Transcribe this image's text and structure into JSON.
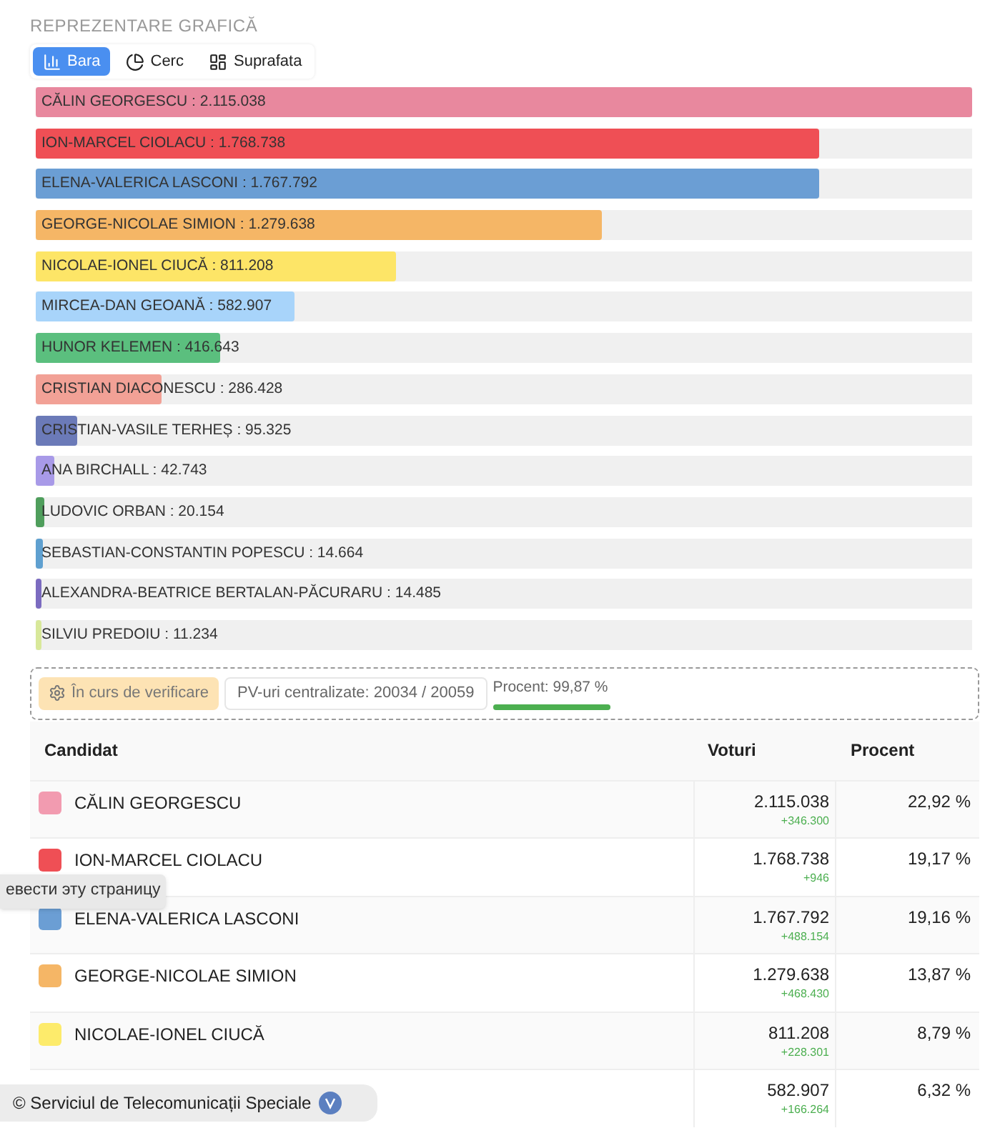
{
  "section_title": "REPREZENTARE GRAFICĂ",
  "tabs": [
    {
      "label": "Bara",
      "selected": true
    },
    {
      "label": "Cerc",
      "selected": false
    },
    {
      "label": "Suprafata",
      "selected": false
    }
  ],
  "bars": [
    {
      "label": "CĂLIN GEORGESCU : 2.115.038",
      "level": 1,
      "color": "#e8889e"
    },
    {
      "label": "ION-MARCEL CIOLACU : 1.768.738",
      "level": 0.836,
      "color": "#ef4f55"
    },
    {
      "label": "ELENA-VALERICA LASCONI : 1.767.792",
      "level": 0.836,
      "color": "#6b9ed4"
    },
    {
      "label": "GEORGE-NICOLAE SIMION : 1.279.638",
      "level": 0.605,
      "color": "#f5b666"
    },
    {
      "label": "NICOLAE-IONEL CIUCĂ : 811.208",
      "level": 0.384,
      "color": "#fde567"
    },
    {
      "label": "MIRCEA-DAN GEOANĂ : 582.907",
      "level": 0.276,
      "color": "#a8d4fa"
    },
    {
      "label": "HUNOR KELEMEN : 416.643",
      "level": 0.197,
      "color": "#5bbf7e"
    },
    {
      "label": "CRISTIAN DIACONESCU : 286.428",
      "level": 0.135,
      "color": "#f2a196"
    },
    {
      "label": "CRISTIAN-VASILE TERHEȘ : 95.325",
      "level": 0.045,
      "color": "#6b7ab8"
    },
    {
      "label": "ANA BIRCHALL : 42.743",
      "level": 0.02,
      "color": "#a89ae8"
    },
    {
      "label": "LUDOVIC ORBAN : 20.154",
      "level": 0.0095,
      "color": "#4f9e5c"
    },
    {
      "label": "SEBASTIAN-CONSTANTIN POPESCU : 14.664",
      "level": 0.0069,
      "color": "#5fa0d0"
    },
    {
      "label": "ALEXANDRA-BEATRICE BERTALAN-PĂCURARU : 14.485",
      "level": 0.0068,
      "color": "#7b6bc0"
    },
    {
      "label": "SILVIU PREDOIU : 11.234",
      "level": 0.0053,
      "color": "#d8e89a"
    }
  ],
  "status": {
    "badge": "În curs de verificare",
    "centralized": "PV-uri centralizate: 20034 / 20059",
    "percent": "Procent: 99,87 %",
    "level": 0.9987
  },
  "table": {
    "columns": [
      "Candidat",
      "Voturi",
      "Procent"
    ],
    "rows": [
      {
        "name": "CĂLIN GEORGESCU",
        "color": "#f29bb0",
        "votes": "2.115.038",
        "delta": "+346.300",
        "percent": "22,92 %"
      },
      {
        "name": "ION-MARCEL CIOLACU",
        "color": "#ef4f55",
        "votes": "1.768.738",
        "delta": "+946",
        "percent": "19,17 %"
      },
      {
        "name": "ELENA-VALERICA LASCONI",
        "color": "#6b9ed4",
        "votes": "1.767.792",
        "delta": "+488.154",
        "percent": "19,16 %"
      },
      {
        "name": "GEORGE-NICOLAE SIMION",
        "color": "#f5b666",
        "votes": "1.279.638",
        "delta": "+468.430",
        "percent": "13,87 %"
      },
      {
        "name": "NICOLAE-IONEL CIUCĂ",
        "color": "#fdeb6b",
        "votes": "811.208",
        "delta": "+228.301",
        "percent": "8,79 %"
      },
      {
        "votes": "582.907",
        "delta": "+166.264",
        "percent": "6,32 %"
      }
    ]
  },
  "translate_tooltip": "евести эту страницу",
  "footer_badge": "© Serviciul de Telecomunicații Speciale"
}
